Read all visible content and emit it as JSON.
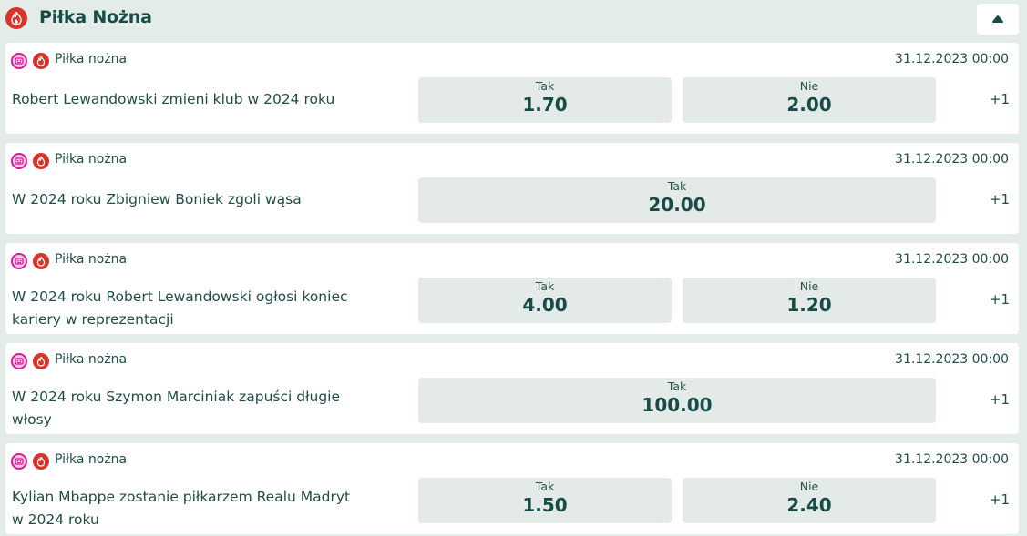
{
  "header": {
    "title": "Piłka Nożna",
    "icon": "fire-icon",
    "collapse_icon": "triangle-up-icon"
  },
  "colors": {
    "accent_red": "#d9342b",
    "pink": "#d41e9a",
    "text_dark": "#174d46",
    "background": "#e4ecea",
    "odd_button": "#e3eae8"
  },
  "events": [
    {
      "sport": "Piłka nożna",
      "date": "31.12.2023 00:00",
      "title_lines": [
        "Robert Lewandowski zmieni klub w 2024 roku"
      ],
      "odds": [
        {
          "label": "Tak",
          "value": "1.70"
        },
        {
          "label": "Nie",
          "value": "2.00"
        }
      ],
      "more": "+1"
    },
    {
      "sport": "Piłka nożna",
      "date": "31.12.2023 00:00",
      "title_lines": [
        "W 2024 roku Zbigniew Boniek zgoli wąsa"
      ],
      "odds": [
        {
          "label": "Tak",
          "value": "20.00"
        }
      ],
      "more": "+1"
    },
    {
      "sport": "Piłka nożna",
      "date": "31.12.2023 00:00",
      "title_lines": [
        "W 2024 roku Robert Lewandowski ogłosi koniec",
        "kariery w reprezentacji"
      ],
      "odds": [
        {
          "label": "Tak",
          "value": "4.00"
        },
        {
          "label": "Nie",
          "value": "1.20"
        }
      ],
      "more": "+1"
    },
    {
      "sport": "Piłka nożna",
      "date": "31.12.2023 00:00",
      "title_lines": [
        "W 2024 roku Szymon Marciniak zapuści długie",
        "włosy"
      ],
      "odds": [
        {
          "label": "Tak",
          "value": "100.00"
        }
      ],
      "more": "+1"
    },
    {
      "sport": "Piłka nożna",
      "date": "31.12.2023 00:00",
      "title_lines": [
        "Kylian Mbappe zostanie piłkarzem Realu Madryt",
        "w 2024 roku"
      ],
      "odds": [
        {
          "label": "Tak",
          "value": "1.50"
        },
        {
          "label": "Nie",
          "value": "2.40"
        }
      ],
      "more": "+1"
    }
  ]
}
